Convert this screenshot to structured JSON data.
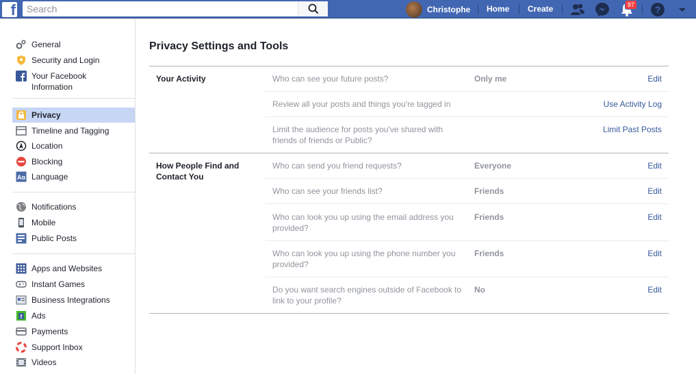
{
  "topbar": {
    "logo": "f",
    "search_placeholder": "Search",
    "user_name": "Christophe",
    "home_label": "Home",
    "create_label": "Create",
    "notification_count": "87",
    "brand_color": "#4267b2"
  },
  "sidebar": {
    "groups": [
      [
        {
          "label": "General",
          "icon": "gears-icon"
        },
        {
          "label": "Security and Login",
          "icon": "shield-icon"
        },
        {
          "label": "Your Facebook Information",
          "icon": "facebook-icon"
        }
      ],
      [
        {
          "label": "Privacy",
          "icon": "lock-icon",
          "active": true
        },
        {
          "label": "Timeline and Tagging",
          "icon": "timeline-icon"
        },
        {
          "label": "Location",
          "icon": "location-icon"
        },
        {
          "label": "Blocking",
          "icon": "blocking-icon"
        },
        {
          "label": "Language",
          "icon": "language-icon"
        }
      ],
      [
        {
          "label": "Notifications",
          "icon": "globe-icon"
        },
        {
          "label": "Mobile",
          "icon": "mobile-icon"
        },
        {
          "label": "Public Posts",
          "icon": "rss-icon"
        }
      ],
      [
        {
          "label": "Apps and Websites",
          "icon": "apps-icon"
        },
        {
          "label": "Instant Games",
          "icon": "gamepad-icon"
        },
        {
          "label": "Business Integrations",
          "icon": "business-icon"
        },
        {
          "label": "Ads",
          "icon": "ads-icon"
        },
        {
          "label": "Payments",
          "icon": "payments-icon"
        },
        {
          "label": "Support Inbox",
          "icon": "lifebuoy-icon"
        },
        {
          "label": "Videos",
          "icon": "film-icon"
        }
      ]
    ]
  },
  "main": {
    "title": "Privacy Settings and Tools",
    "sections": [
      {
        "label": "Your Activity",
        "rows": [
          {
            "question": "Who can see your future posts?",
            "value": "Only me",
            "action": "Edit"
          },
          {
            "question": "Review all your posts and things you're tagged in",
            "value": "",
            "action": "Use Activity Log"
          },
          {
            "question": "Limit the audience for posts you've shared with friends of friends or Public?",
            "value": "",
            "action": "Limit Past Posts"
          }
        ]
      },
      {
        "label": "How People Find and Contact You",
        "rows": [
          {
            "question": "Who can send you friend requests?",
            "value": "Everyone",
            "action": "Edit"
          },
          {
            "question": "Who can see your friends list?",
            "value": "Friends",
            "action": "Edit"
          },
          {
            "question": "Who can look you up using the email address you provided?",
            "value": "Friends",
            "action": "Edit"
          },
          {
            "question": "Who can look you up using the phone number you provided?",
            "value": "Friends",
            "action": "Edit"
          },
          {
            "question": "Do you want search engines outside of Facebook to link to your profile?",
            "value": "No",
            "action": "Edit"
          }
        ]
      }
    ]
  }
}
